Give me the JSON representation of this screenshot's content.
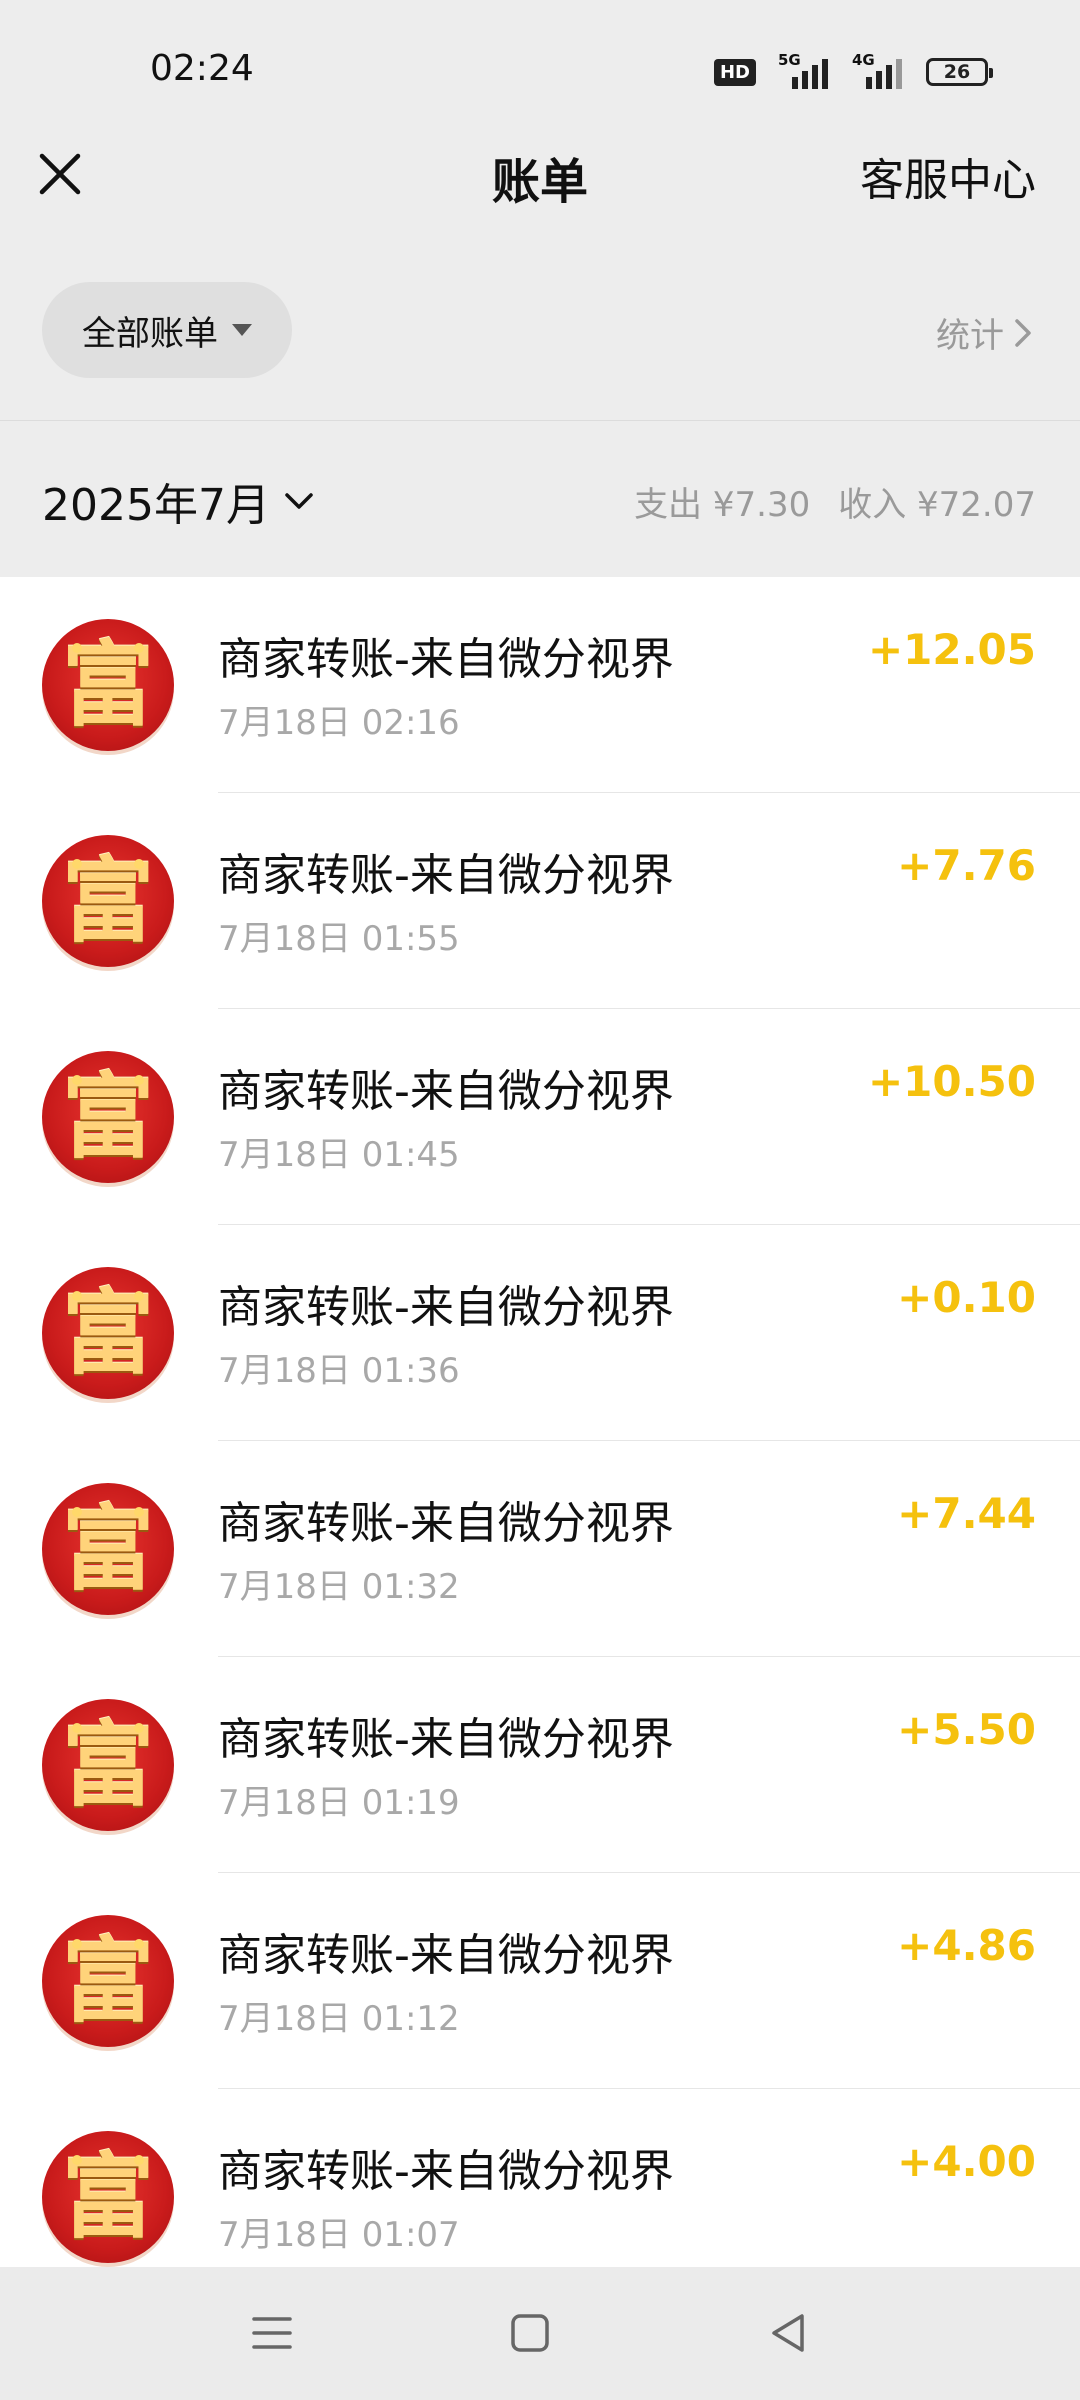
{
  "status_bar": {
    "time": "02:24",
    "hd_label": "HD",
    "net_1": "5G",
    "net_2": "4G",
    "battery": "26"
  },
  "header": {
    "title": "账单",
    "service_label": "客服中心",
    "close_icon": "close-icon"
  },
  "filter": {
    "label": "全部账单",
    "stats_label": "统计"
  },
  "month": {
    "label": "2025年7月",
    "expense": "支出 ¥7.30",
    "income": "收入 ¥72.07"
  },
  "transactions": [
    {
      "title": "商家转账-来自微分视界",
      "time": "7月18日 02:16",
      "amount": "+12.05",
      "avatar": "富"
    },
    {
      "title": "商家转账-来自微分视界",
      "time": "7月18日 01:55",
      "amount": "+7.76",
      "avatar": "富"
    },
    {
      "title": "商家转账-来自微分视界",
      "time": "7月18日 01:45",
      "amount": "+10.50",
      "avatar": "富"
    },
    {
      "title": "商家转账-来自微分视界",
      "time": "7月18日 01:36",
      "amount": "+0.10",
      "avatar": "富"
    },
    {
      "title": "商家转账-来自微分视界",
      "time": "7月18日 01:32",
      "amount": "+7.44",
      "avatar": "富"
    },
    {
      "title": "商家转账-来自微分视界",
      "time": "7月18日 01:19",
      "amount": "+5.50",
      "avatar": "富"
    },
    {
      "title": "商家转账-来自微分视界",
      "time": "7月18日 01:12",
      "amount": "+4.86",
      "avatar": "富"
    },
    {
      "title": "商家转账-来自微分视界",
      "time": "7月18日 01:07",
      "amount": "+4.00",
      "avatar": "富"
    }
  ],
  "colors": {
    "income_amount": "#f5c10e",
    "avatar_red": "#c91b1b"
  }
}
